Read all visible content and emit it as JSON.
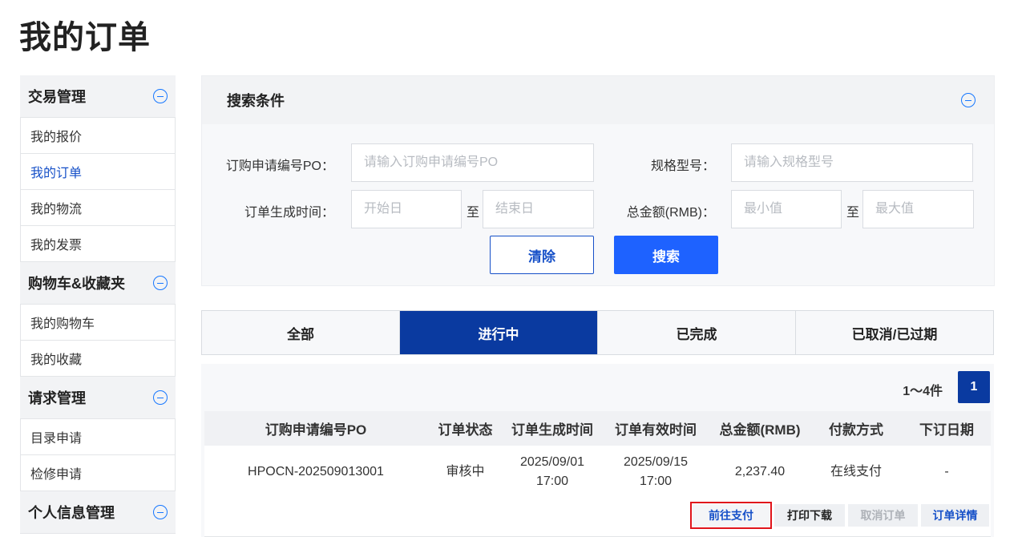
{
  "page": {
    "title": "我的订单"
  },
  "sidebar": {
    "groups": [
      {
        "title": "交易管理",
        "items": [
          "我的报价",
          "我的订单",
          "我的物流",
          "我的发票"
        ]
      },
      {
        "title": "购物车&收藏夹",
        "items": [
          "我的购物车",
          "我的收藏"
        ]
      },
      {
        "title": "请求管理",
        "items": [
          "目录申请",
          "检修申请"
        ]
      },
      {
        "title": "个人信息管理",
        "items": []
      }
    ],
    "active_item": "我的订单"
  },
  "search": {
    "title": "搜索条件",
    "po_label": "订购申请编号PO：",
    "po_placeholder": "请输入订购申请编号PO",
    "spec_label": "规格型号：",
    "spec_placeholder": "请输入规格型号",
    "date_label": "订单生成时间：",
    "date_start_placeholder": "开始日",
    "date_sep": "至",
    "date_end_placeholder": "结束日",
    "amount_label": "总金额(RMB)：",
    "amount_min_placeholder": "最小值",
    "amount_sep": "至",
    "amount_max_placeholder": "最大值",
    "clear_label": "清除",
    "search_label": "搜索"
  },
  "tabs": [
    {
      "label": "全部",
      "active": false
    },
    {
      "label": "进行中",
      "active": true
    },
    {
      "label": "已完成",
      "active": false
    },
    {
      "label": "已取消/已过期",
      "active": false
    }
  ],
  "results": {
    "count_text": "1～4件",
    "current_page": "1",
    "columns": [
      "订购申请编号PO",
      "订单状态",
      "订单生成时间",
      "订单有效时间",
      "总金额(RMB)",
      "付款方式",
      "下订日期"
    ],
    "rows": [
      {
        "po": "HPOCN-202509013001",
        "status": "审核中",
        "created_date": "2025/09/01",
        "created_time": "17:00",
        "valid_date": "2025/09/15",
        "valid_time": "17:00",
        "amount": "2,237.40",
        "payment": "在线支付",
        "order_date": "-",
        "actions": {
          "pay": "前往支付",
          "print": "打印下载",
          "cancel": "取消订单",
          "detail": "订单详情"
        }
      }
    ]
  },
  "colors": {
    "primary_dark": "#0a3aa0",
    "primary": "#1e62ff",
    "link": "#1650c8",
    "highlight_border": "#e0141b"
  }
}
